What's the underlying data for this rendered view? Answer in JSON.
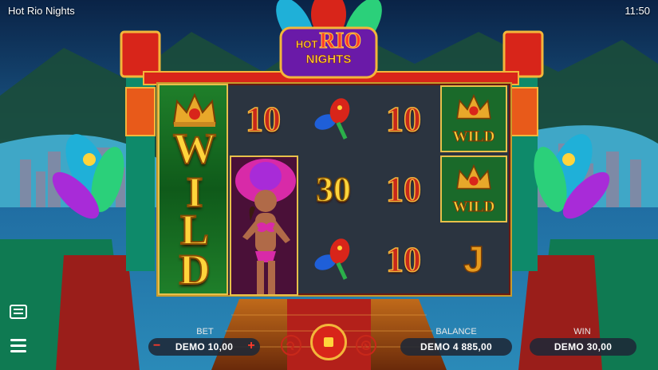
{
  "app": {
    "title": "Hot Rio Nights",
    "time": "11:50"
  },
  "logo": {
    "line1": "HOT",
    "line2": "RIO",
    "line3": "NIGHTS"
  },
  "reels": {
    "col2": [
      "10",
      "",
      ""
    ],
    "col3": [
      "",
      "30",
      ""
    ],
    "col4": [
      "10",
      "10",
      "10"
    ],
    "col5_bottom": "J",
    "wild_letters": [
      "W",
      "I",
      "L",
      "D"
    ],
    "wild_tile_label": "WILD"
  },
  "controls": {
    "bet_label": "BET",
    "bet_value": "DEMO 10,00",
    "balance_label": "BALANCE",
    "balance_value": "DEMO 4 885,00",
    "win_label": "WIN",
    "win_value": "DEMO 30,00",
    "minus": "−",
    "plus": "+"
  },
  "icons": [
    "menu-icon",
    "paytable-icon",
    "autoplay-icon",
    "turbo-icon",
    "spin-stop-icon",
    "bet-minus-icon",
    "bet-plus-icon"
  ],
  "colors": {
    "accent_red": "#d8251a",
    "gold": "#ffd43b",
    "green": "#1f7f2a"
  }
}
